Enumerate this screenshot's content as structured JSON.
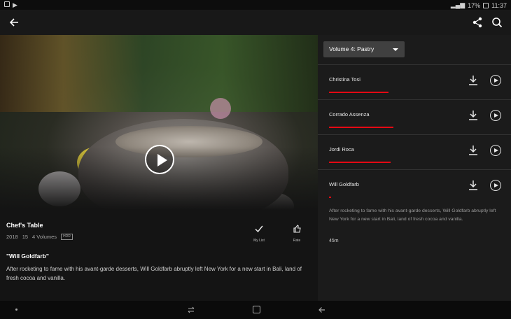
{
  "status_bar": {
    "battery": "17%",
    "time": "11:37"
  },
  "icons": {
    "back": "arrow-left-icon",
    "share": "share-icon",
    "search": "search-icon",
    "play": "play-icon",
    "check": "check-icon",
    "thumbs_up": "thumbs-up-icon",
    "download": "download-icon",
    "caret": "caret-down-icon"
  },
  "show": {
    "title": "Chef's Table",
    "year": "2018",
    "rating": "15",
    "volumes": "4 Volumes",
    "badge": "HDR",
    "my_list_label": "My List",
    "rate_label": "Rate",
    "episode_heading": "\"Will Goldfarb\"",
    "synopsis": "After rocketing to fame with his avant-garde desserts, Will Goldfarb abruptly left New York for a new start in Bali, land of fresh cocoa and vanilla."
  },
  "season_selector": {
    "selected": "Volume 4: Pastry"
  },
  "episodes": [
    {
      "name": "Christina Tosi",
      "progress": 0.5
    },
    {
      "name": "Corrado Assenza",
      "progress": 0.54
    },
    {
      "name": "Jordi Roca",
      "progress": 0.52
    },
    {
      "name": "Will Goldfarb",
      "progress": 0.02
    }
  ],
  "selected_episode": {
    "description": "After rocketing to fame with his avant-garde desserts, Will Goldfarb abruptly left New York for a new start in Bali, land of fresh cocoa and vanilla.",
    "duration": "45m"
  },
  "colors": {
    "accent": "#e50914",
    "background": "#141414",
    "panel": "#1b1b1b"
  }
}
